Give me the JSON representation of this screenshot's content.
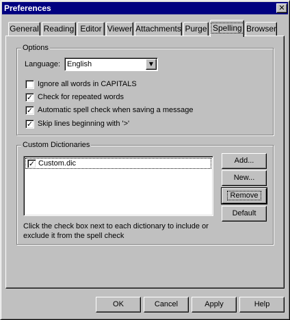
{
  "window": {
    "title": "Preferences",
    "close_glyph": "✕"
  },
  "tabs": [
    {
      "label": "General"
    },
    {
      "label": "Reading"
    },
    {
      "label": "Editor"
    },
    {
      "label": "Viewer"
    },
    {
      "label": "Attachments"
    },
    {
      "label": "Purge"
    },
    {
      "label": "Spelling",
      "active": true
    },
    {
      "label": "Browser"
    }
  ],
  "options": {
    "group_label": "Options",
    "language_label": "Language:",
    "language_value": "English",
    "checkboxes": [
      {
        "label": "Ignore all words in CAPITALS",
        "checked": false
      },
      {
        "label": "Check for repeated words",
        "checked": true
      },
      {
        "label": "Automatic spell check when saving a message",
        "checked": true
      },
      {
        "label": "Skip lines beginning with '>'",
        "checked": true
      }
    ]
  },
  "dictionaries": {
    "group_label": "Custom Dictionaries",
    "items": [
      {
        "label": "Custom.dic",
        "checked": true
      }
    ],
    "buttons": {
      "add": "Add...",
      "new": "New...",
      "remove": "Remove",
      "default": "Default"
    },
    "note": "Click the check box next to each dictionary to include or exclude it from the spell check"
  },
  "footer": {
    "ok": "OK",
    "cancel": "Cancel",
    "apply": "Apply",
    "help": "Help"
  },
  "check_glyph": "✓"
}
